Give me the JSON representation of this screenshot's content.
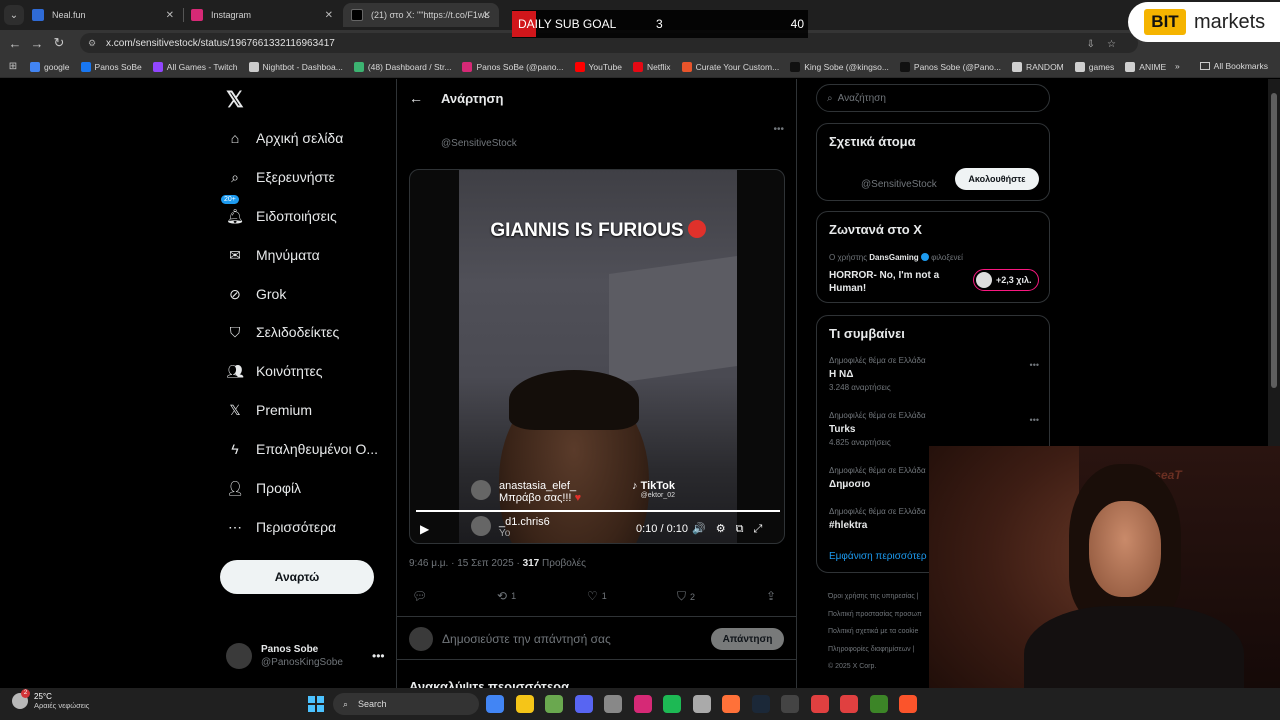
{
  "browser": {
    "tabs": [
      {
        "title": "Neal.fun",
        "color": "#2f6bd6"
      },
      {
        "title": "Instagram",
        "color": "#d62976"
      },
      {
        "title": "(21) στο X: \"\"https://t.co/F1wLi",
        "color": "#000000"
      }
    ],
    "url": "x.com/sensitivestock/status/1967661332116963417",
    "bookmarks": [
      {
        "label": "google",
        "color": "#4285f4"
      },
      {
        "label": "Panos SoBe",
        "color": "#1877f2"
      },
      {
        "label": "All Games - Twitch",
        "color": "#9146ff"
      },
      {
        "label": "Nightbot - Dashboa...",
        "color": "#cccccc"
      },
      {
        "label": "(48) Dashboard / Str...",
        "color": "#3cb371"
      },
      {
        "label": "Panos SoBe (@pano...",
        "color": "#d62976"
      },
      {
        "label": "YouTube",
        "color": "#ff0000"
      },
      {
        "label": "Netflix",
        "color": "#e50914"
      },
      {
        "label": "Curate Your Custom...",
        "color": "#e8542b"
      },
      {
        "label": "King Sobe (@kingso...",
        "color": "#111111"
      },
      {
        "label": "Panos Sobe (@Pano...",
        "color": "#111111"
      },
      {
        "label": "RANDOM",
        "color": "#cfcfcf"
      },
      {
        "label": "games",
        "color": "#cfcfcf"
      },
      {
        "label": "ANIME",
        "color": "#cfcfcf"
      }
    ],
    "all_bookmarks": "All Bookmarks"
  },
  "overlay": {
    "subgoal_label": "DAILY SUB GOAL",
    "subgoal_current": "3",
    "subgoal_target": "40",
    "sponsor_logo": "BIT",
    "sponsor_name": "markets"
  },
  "nav": {
    "items": [
      {
        "label": "Αρχική σελίδα",
        "icon": "home-icon"
      },
      {
        "label": "Εξερευνήστε",
        "icon": "search-icon"
      },
      {
        "label": "Ειδοποιήσεις",
        "icon": "bell-icon"
      },
      {
        "label": "Μηνύματα",
        "icon": "mail-icon"
      },
      {
        "label": "Grok",
        "icon": "grok-icon"
      },
      {
        "label": "Σελιδοδείκτες",
        "icon": "bookmark-icon"
      },
      {
        "label": "Κοινότητες",
        "icon": "communities-icon"
      },
      {
        "label": "Premium",
        "icon": "x-logo-icon"
      },
      {
        "label": "Επαληθευμένοι Ο...",
        "icon": "lightning-icon"
      },
      {
        "label": "Προφίλ",
        "icon": "profile-icon"
      },
      {
        "label": "Περισσότερα",
        "icon": "more-circle-icon"
      }
    ],
    "notif_badge": "20+",
    "post_button": "Αναρτώ",
    "profile_name": "Panos Sobe",
    "profile_handle": "@PanosKingSobe"
  },
  "post": {
    "header_title": "Ανάρτηση",
    "handle": "@SensitiveStock",
    "video_caption": "GIANNIS IS FURIOUS",
    "comment1_name": "anastasia_elef_",
    "comment1_text": "Μπράβο σας!!!",
    "comment2_name": "_d1.chris6",
    "comment2_text": "Yo",
    "tiktok_brand": "TikTok",
    "tiktok_user": "@ektor_02",
    "video_time": "0:10 / 0:10",
    "video_progress": 1.0,
    "timestamp": "9:46 μ.μ. · 15 Σεπ 2025 · ",
    "views": "317",
    "views_label": " Προβολές",
    "replies": "",
    "reposts": "1",
    "likes": "1",
    "bookmarks": "2",
    "reply_placeholder": "Δημοσιεύστε την απάντησή σας",
    "reply_button": "Απάντηση",
    "discover": "Ανακαλύψτε περισσότερα"
  },
  "sidebar": {
    "search_placeholder": "Αναζήτηση",
    "related_title": "Σχετικά άτομα",
    "related_handle": "@SensitiveStock",
    "follow_button": "Ακολουθήστε",
    "live_title": "Ζωντανά στο X",
    "live_prefix": "Ο χρήστης ",
    "live_user": "DansGaming",
    "live_suffix": " φιλοξενεί",
    "live_stream_title": "HORROR- No, I'm not a Human!",
    "live_count": "+2,3 χιλ.",
    "trends_title": "Τι συμβαίνει",
    "trends": [
      {
        "context": "Δημοφιλές θέμα σε Ελλάδα",
        "name": "Η ΝΔ",
        "count": "3.248 αναρτήσεις"
      },
      {
        "context": "Δημοφιλές θέμα σε Ελλάδα",
        "name": "Turks",
        "count": "4.825 αναρτήσεις"
      },
      {
        "context": "Δημοφιλές θέμα σε Ελλάδα",
        "name": "Δημοσιο",
        "count": ""
      },
      {
        "context": "Δημοφιλές θέμα σε Ελλάδα",
        "name": "#hlektra",
        "count": ""
      }
    ],
    "show_more": "Εμφάνιση περισσότερ",
    "footer": [
      "Όροι χρήσης της υπηρεσίας |",
      "Πολιτική προστασίας προσωπ",
      "Πολιτική σχετικά με τα cookie",
      "Πληροφορίες διαφημίσεων |",
      "© 2025 X Corp."
    ]
  },
  "webcam": {
    "chair_brand": "da seaT"
  },
  "taskbar": {
    "temperature": "25°C",
    "weather": "Αραιές νεφώσεις",
    "weather_badge": "2",
    "search": "Search",
    "apps": [
      "#4285f4",
      "#f5c518",
      "#6aa84f",
      "#5865f2",
      "#888888",
      "#d62976",
      "#1db954",
      "#aaaaaa",
      "#ff7139",
      "#1b2838",
      "#444444",
      "#e04040",
      "#e04040",
      "#3c8527",
      "#fb542b"
    ]
  }
}
